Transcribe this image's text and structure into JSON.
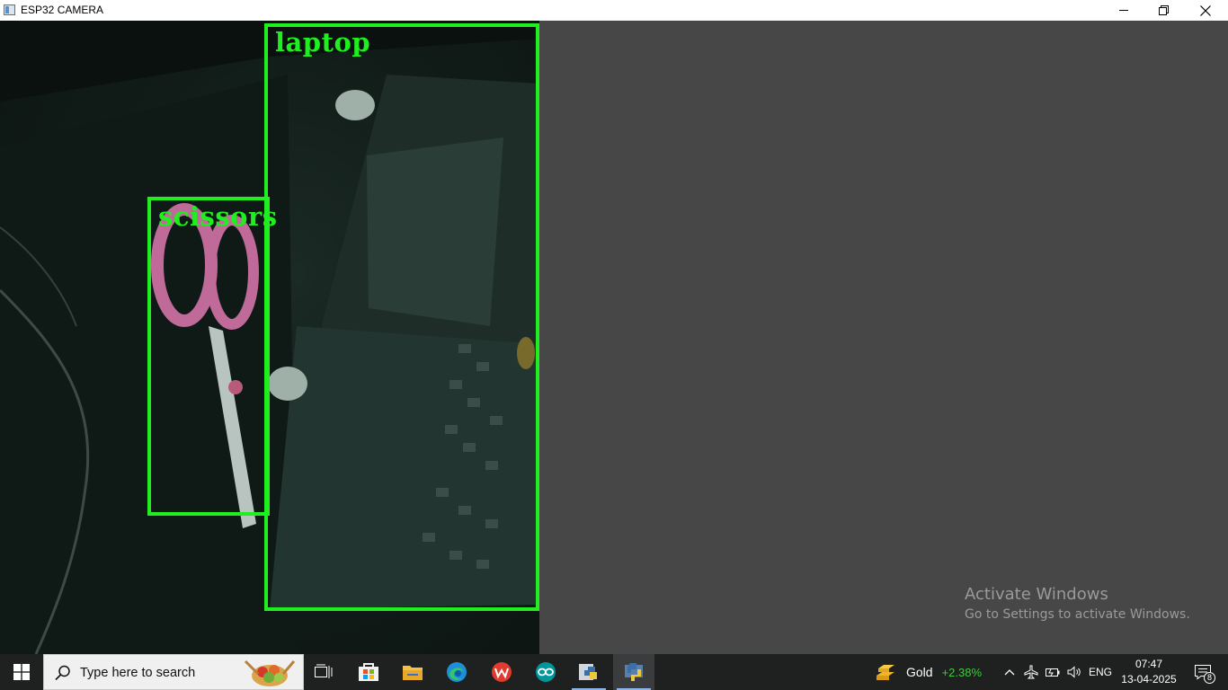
{
  "window": {
    "title": "ESP32 CAMERA",
    "icons": [
      "app-icon",
      "minimize-icon",
      "restore-icon",
      "close-icon"
    ]
  },
  "camera": {
    "detections": [
      {
        "label": "laptop"
      },
      {
        "label": "scissors"
      }
    ],
    "box_color": "#1fef1f"
  },
  "watermark": {
    "title": "Activate Windows",
    "subtitle": "Go to Settings to activate Windows."
  },
  "taskbar": {
    "search": {
      "placeholder": "Type here to search"
    },
    "apps": [
      "task-view-icon",
      "microsoft-store-icon",
      "file-explorer-icon",
      "edge-icon",
      "wps-office-icon",
      "arduino-icon",
      "python-idle-icon",
      "python-icon"
    ],
    "tray": {
      "gold_label": "Gold",
      "gold_change": "+2.38%",
      "language": "ENG",
      "time": "07:47",
      "date": "13-04-2025",
      "notifications": "8"
    }
  }
}
